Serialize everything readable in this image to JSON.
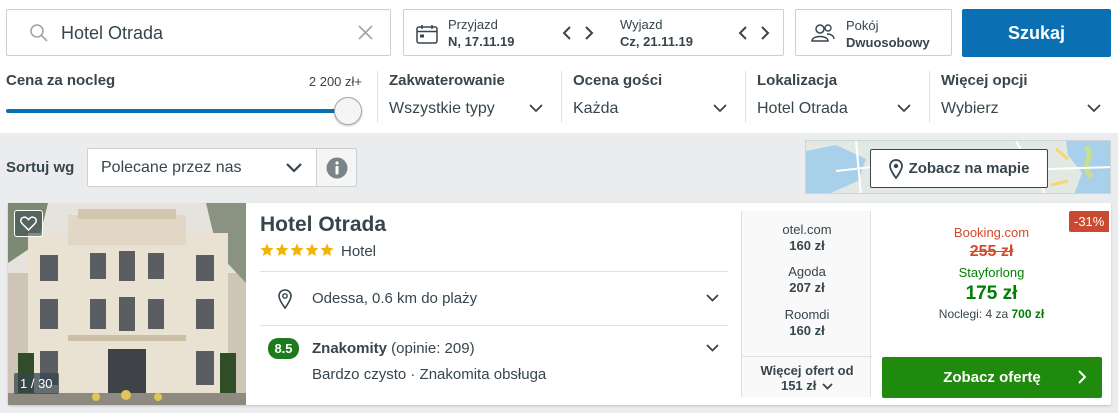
{
  "search": {
    "value": "Hotel Otrada"
  },
  "dates": {
    "checkin_label": "Przyjazd",
    "checkin_value": "N, 17.11.19",
    "checkout_label": "Wyjazd",
    "checkout_value": "Cz, 21.11.19"
  },
  "room": {
    "label": "Pokój",
    "value": "Dwuosobowy"
  },
  "search_button": "Szukaj",
  "filters": {
    "price_label": "Cena za nocleg",
    "price_max": "2 200 zł+",
    "price_level": 1.0,
    "accommodation": {
      "title": "Zakwaterowanie",
      "value": "Wszystkie typy"
    },
    "rating": {
      "title": "Ocena gości",
      "value": "Każda"
    },
    "location": {
      "title": "Lokalizacja",
      "value": "Hotel Otrada"
    },
    "more": {
      "title": "Więcej opcji",
      "value": "Wybierz"
    }
  },
  "sort": {
    "label": "Sortuj wg",
    "value": "Polecane przez nas"
  },
  "map_button": "Zobacz na mapie",
  "hotel": {
    "name": "Hotel Otrada",
    "stars": 5,
    "type": "Hotel",
    "location": "Odessa, 0.6 km do plaży",
    "rating_score": "8.5",
    "rating_word": "Znakomity",
    "rating_count": " (opinie: 209)",
    "highlights": "Bardzo czysto · Znakomita obsługa",
    "photo_counter": "1 / 30"
  },
  "offers": [
    {
      "site": "otel.com",
      "price": "160 zł"
    },
    {
      "site": "Agoda",
      "price": "207 zł"
    },
    {
      "site": "Roomdi",
      "price": "160 zł"
    }
  ],
  "more_offers": {
    "label": "Więcej ofert od",
    "price": "151 zł"
  },
  "best_deal": {
    "discount": "-31%",
    "compare_site": "Booking.com",
    "old_price": "255 zł",
    "partner": "Stayforlong",
    "price": "175 zł",
    "nights_label": "Noclegi: 4 za ",
    "nights_total": "700 zł",
    "button": "Zobacz ofertę"
  },
  "colors": {
    "accent": "#0a6fb3",
    "deal": "#1f8a0d",
    "discount": "#c94a30",
    "star": "#f5b301"
  }
}
